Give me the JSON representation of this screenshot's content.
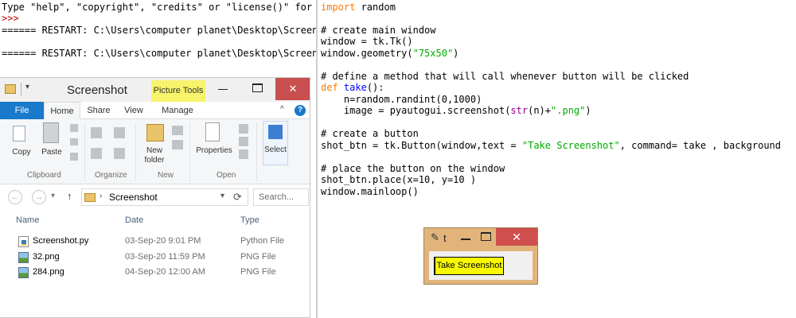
{
  "shell": {
    "lines": [
      "Type \"help\", \"copyright\", \"credits\" or \"license()\" for more information.",
      ">>>",
      "====== RESTART: C:\\Users\\computer planet\\Desktop\\Screenshot.py ======",
      "====== RESTART: C:\\Users\\computer planet\\Desktop\\Screenshot.py ======"
    ]
  },
  "editor": {
    "l1_kw": "import",
    "l1_rest": " random",
    "l2_cm": "# create main window",
    "l3": "window = tk.Tk()",
    "l4_a": "window.geometry(",
    "l4_str": "\"75x50\"",
    "l4_b": ")",
    "l5_cm": "# define a method that will call whenever button will be clicked",
    "l6_kw": "def",
    "l6_fn": " take",
    "l6_rest": "():",
    "l7": "    n=random.randint(0,1000)",
    "l8_a": "    image = pyautogui.screenshot(",
    "l8_bi": "str",
    "l8_b": "(n)+",
    "l8_str": "\".png\"",
    "l8_c": ")",
    "l9_cm": "# create a button",
    "l10_a": "shot_btn = tk.Button(window,text = ",
    "l10_str": "\"Take Screenshot\"",
    "l10_b": ", command= take , background",
    "l11_cm": "# place the button on the window",
    "l12": "shot_btn.place(x=10, y=10 )",
    "l13": "window.mainloop()"
  },
  "explorer": {
    "title": "Screenshot",
    "picture_tools": "Picture Tools",
    "qat_dropdown": "▾",
    "window_buttons": {
      "close": "✕"
    },
    "tabs": [
      "File",
      "Home",
      "Share",
      "View",
      "Manage"
    ],
    "help": "?",
    "collapse": "^",
    "ribbon": {
      "copy": "Copy",
      "paste": "Paste",
      "clipboard": "Clipboard",
      "organize": "Organize",
      "new_folder_line1": "New",
      "new_folder_line2": "folder",
      "new": "New",
      "properties": "Properties",
      "open": "Open",
      "select": "Select"
    },
    "address": {
      "back": "←",
      "forward": "→",
      "recent": "▾",
      "up": "↑",
      "chevron": "›",
      "path": "Screenshot",
      "dropdown": "▾",
      "refresh": "⟳",
      "search_placeholder": "Search..."
    },
    "columns": {
      "name": "Name",
      "date": "Date",
      "type": "Type"
    },
    "files": [
      {
        "name": "Screenshot.py",
        "date": "03-Sep-20 9:01 PM",
        "type": "Python File",
        "icon": "python-file-icon"
      },
      {
        "name": "32.png",
        "date": "03-Sep-20 11:59 PM",
        "type": "PNG File",
        "icon": "png-file-icon"
      },
      {
        "name": "284.png",
        "date": "04-Sep-20 12:00 AM",
        "type": "PNG File",
        "icon": "png-file-icon"
      }
    ]
  },
  "tk": {
    "title": "t",
    "feather": "✎",
    "close": "✕",
    "button": "Take Screenshot",
    "button_color": "#f9f900"
  }
}
